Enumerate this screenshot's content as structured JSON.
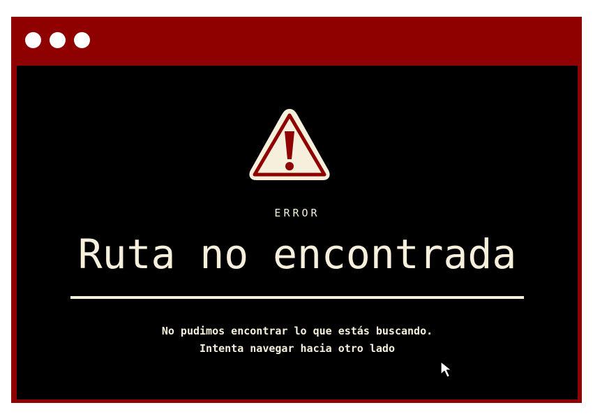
{
  "window": {
    "controls": [
      "dot-1",
      "dot-2",
      "dot-3"
    ]
  },
  "error": {
    "icon": "warning-icon",
    "label": "ERROR",
    "title": "Ruta no encontrada",
    "message_line_1": "No pudimos encontrar lo que estás buscando.",
    "message_line_2": "Intenta navegar hacia otro lado"
  },
  "cursor": {
    "icon": "pointer-cursor-icon"
  },
  "colors": {
    "frame": "#8f0000",
    "screen": "#000000",
    "text": "#f6efdc",
    "accent": "#8f0000"
  }
}
